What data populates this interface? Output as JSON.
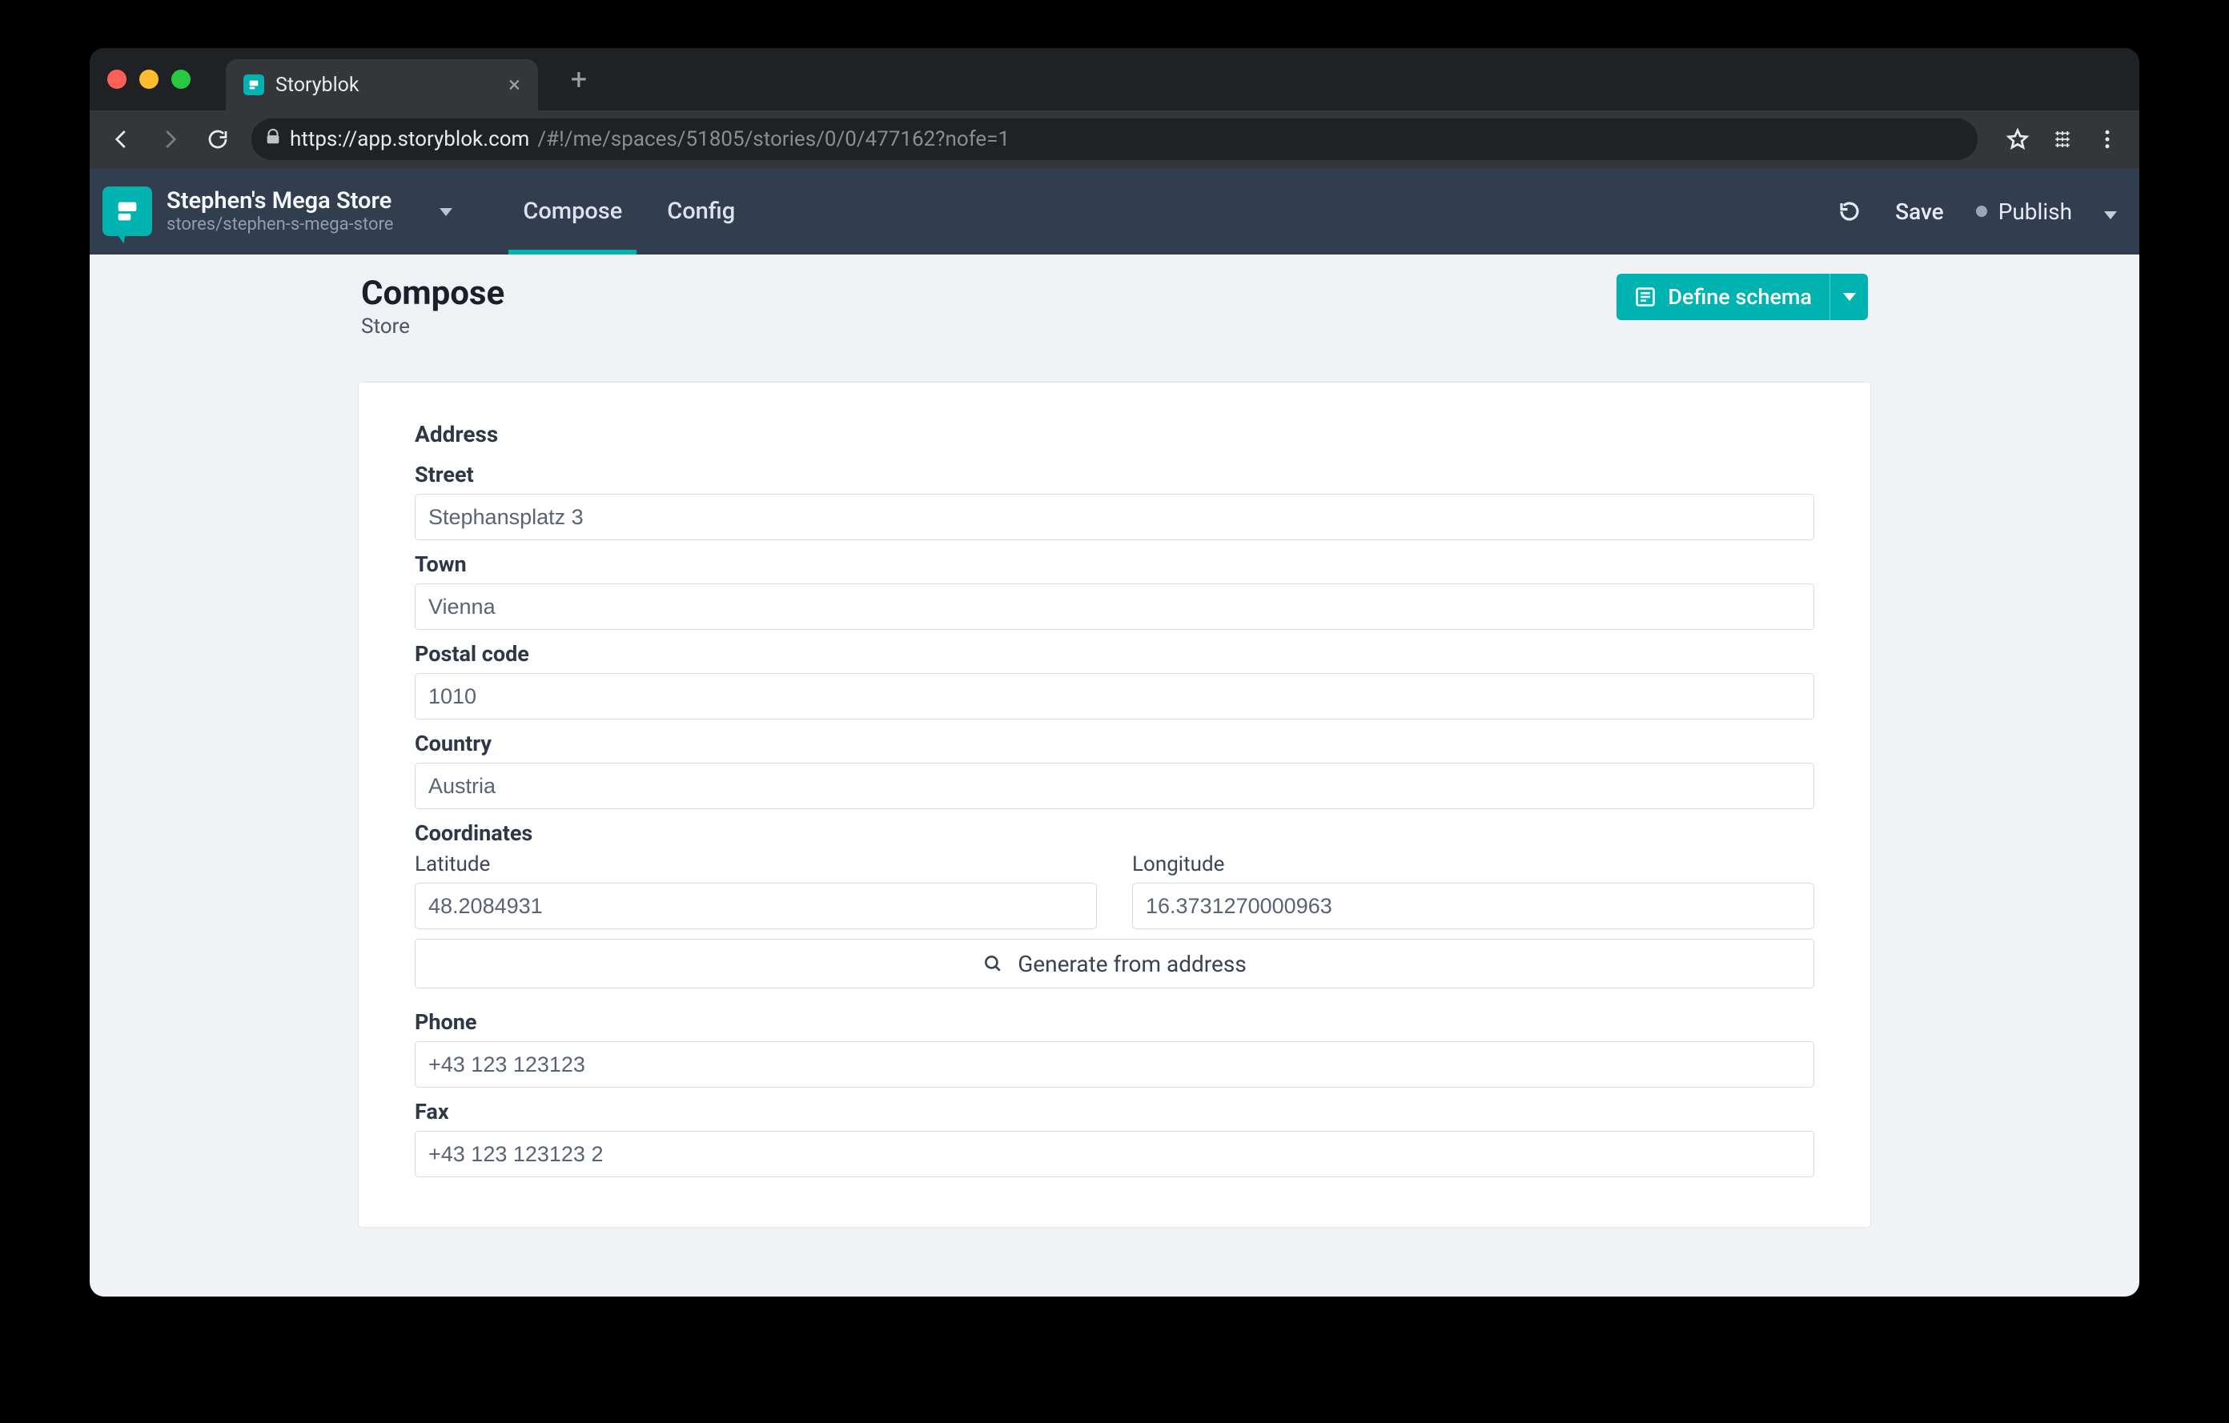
{
  "browser": {
    "tab_title": "Storyblok",
    "url_host": "https://app.storyblok.com",
    "url_path": "/#!/me/spaces/51805/stories/0/0/477162?nofe=1"
  },
  "appbar": {
    "title": "Stephen's Mega Store",
    "subtitle": "stores/stephen-s-mega-store",
    "tabs": {
      "compose": "Compose",
      "config": "Config"
    },
    "save": "Save",
    "publish": "Publish"
  },
  "page": {
    "title": "Compose",
    "subtitle": "Store",
    "define_schema": "Define schema"
  },
  "form": {
    "section_address": "Address",
    "street": {
      "label": "Street",
      "value": "Stephansplatz 3"
    },
    "town": {
      "label": "Town",
      "value": "Vienna"
    },
    "postal_code": {
      "label": "Postal code",
      "value": "1010"
    },
    "country": {
      "label": "Country",
      "value": "Austria"
    },
    "coordinates_label": "Coordinates",
    "latitude": {
      "label": "Latitude",
      "value": "48.2084931"
    },
    "longitude": {
      "label": "Longitude",
      "value": "16.3731270000963"
    },
    "generate": "Generate from address",
    "phone": {
      "label": "Phone",
      "value": "+43 123 123123"
    },
    "fax": {
      "label": "Fax",
      "value": "+43 123 123123 2"
    }
  }
}
